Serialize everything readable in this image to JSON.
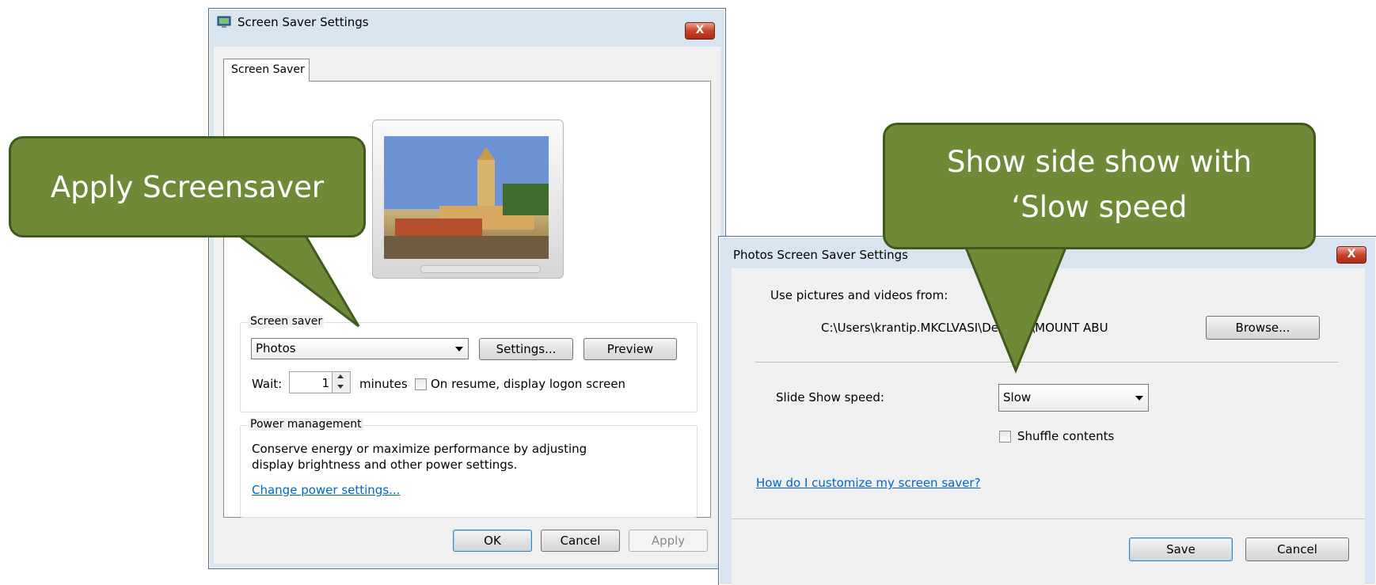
{
  "screensaver_dialog": {
    "title": "Screen Saver Settings",
    "close_label": "X",
    "tab_label": "Screen Saver",
    "screen_saver_group": {
      "legend": "Screen saver",
      "selected": "Photos",
      "settings_label": "Settings...",
      "preview_label": "Preview",
      "wait_label": "Wait:",
      "wait_value": "1",
      "minutes_label": "minutes",
      "resume_label": "On resume, display logon screen"
    },
    "power_group": {
      "legend": "Power management",
      "description": "Conserve energy or maximize performance by adjusting display brightness and other power settings.",
      "link": "Change power settings..."
    },
    "ok_label": "OK",
    "cancel_label": "Cancel",
    "apply_label": "Apply"
  },
  "photos_dialog": {
    "title": "Photos Screen Saver Settings",
    "close_label": "X",
    "source_label": "Use pictures and videos from:",
    "path": "C:\\Users\\krantip.MKCLVASI\\Desktop\\MOUNT ABU",
    "browse_label": "Browse...",
    "speed_label": "Slide Show speed:",
    "speed_value": "Slow",
    "shuffle_label": "Shuffle contents",
    "help_link": "How do I customize my screen saver?",
    "save_label": "Save",
    "cancel_label": "Cancel"
  },
  "callouts": {
    "apply": "Apply Screensaver",
    "slow_line1": "Show side show with",
    "slow_line2": "‘Slow speed"
  },
  "colors": {
    "callout_fill": "#6e8a37",
    "link": "#0066cc",
    "close_button": "#c8412b"
  }
}
